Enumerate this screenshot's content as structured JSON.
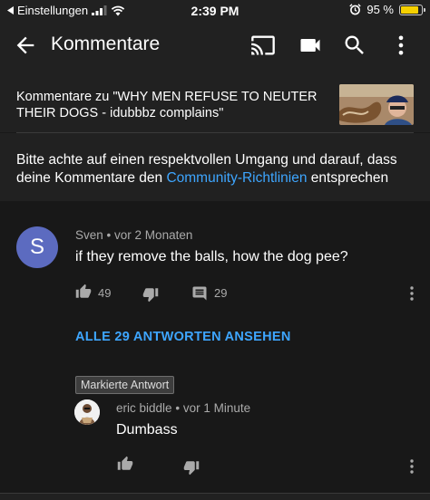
{
  "status_bar": {
    "back_app": "Einstellungen",
    "time": "2:39 PM",
    "battery": "95 %",
    "battery_color": "#f5d000"
  },
  "app_bar": {
    "title": "Kommentare",
    "icons": [
      "back-arrow-icon",
      "cast-icon",
      "camera-icon",
      "search-icon",
      "more-vert-icon"
    ]
  },
  "video": {
    "title": "Kommentare zu \"WHY MEN REFUSE TO NEUTER THEIR DOGS - idubbbz complains\""
  },
  "guidelines": {
    "text_before": "Bitte achte auf einen respektvollen Umgang und darauf, dass deine Kommentare den ",
    "link": "Community-Richtlinien",
    "text_after": " entsprechen",
    "link_color": "#3ea6ff"
  },
  "comment": {
    "avatar_letter": "S",
    "avatar_color": "#5c6bc0",
    "author": "Sven",
    "separator": "•",
    "time": "vor 2 Monaten",
    "text": "if they remove the balls, how the dog pee?",
    "likes": "49",
    "replies": "29"
  },
  "view_replies": "ALLE 29 ANTWORTEN ANSEHEN",
  "reply": {
    "badge": "Markierte Antwort",
    "author": "eric biddle",
    "separator": "•",
    "time": "vor 1 Minute",
    "text": "Dumbass"
  }
}
